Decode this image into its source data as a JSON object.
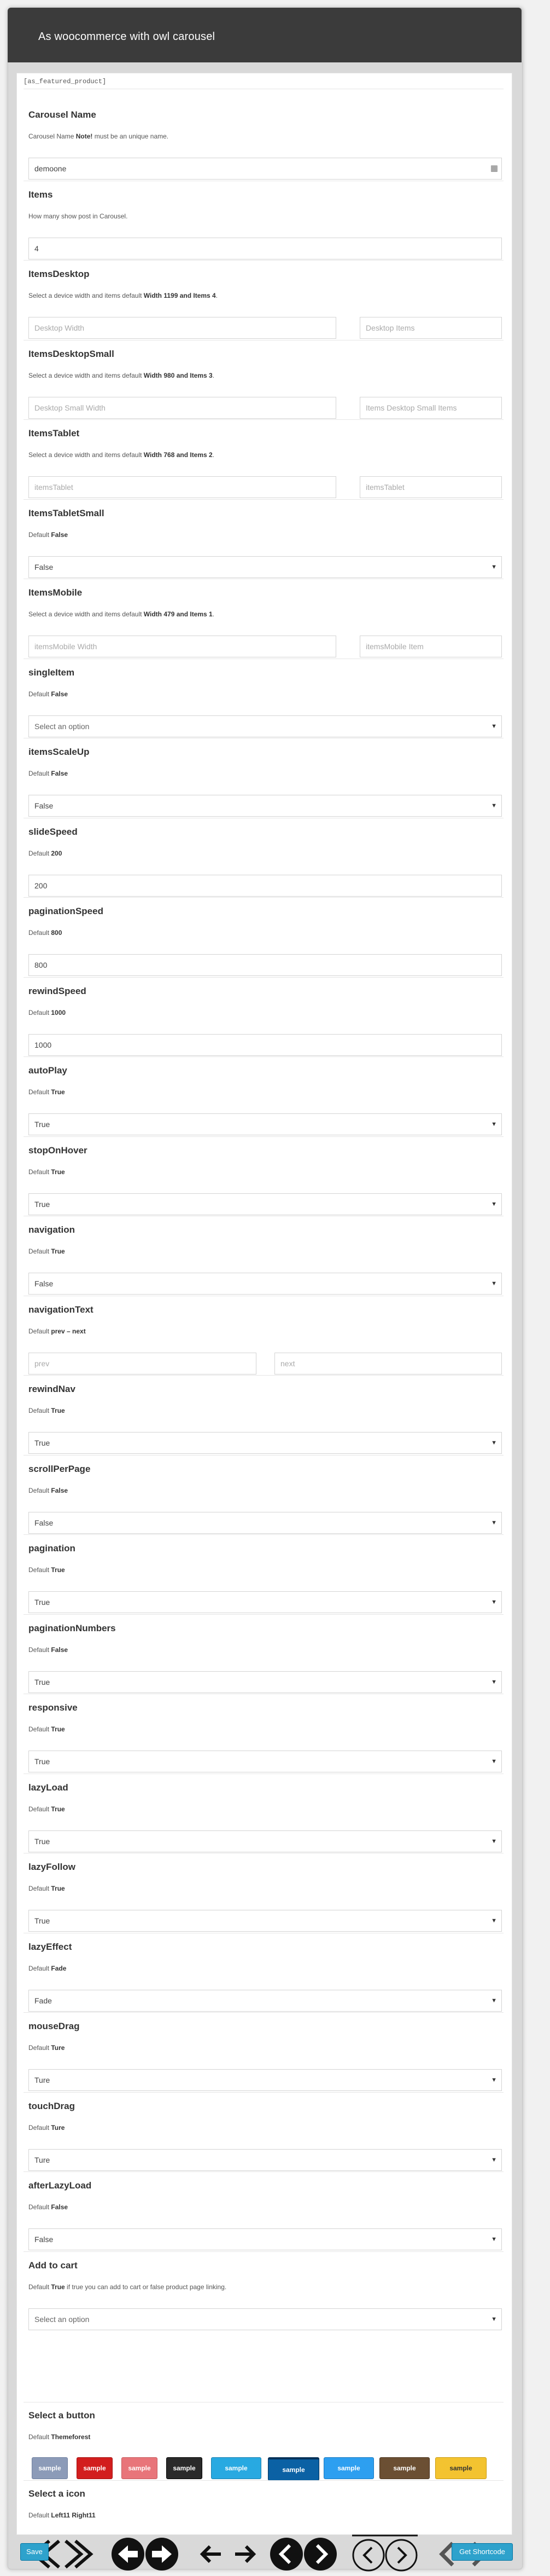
{
  "window": {
    "title": "As woocommerce with owl carousel"
  },
  "shortcode": "[as_featured_product]",
  "fields": [
    {
      "key": "carousel_name",
      "label": "Carousel Name",
      "desc": "Carousel Name <b>Note!</b> must be an unique name.",
      "type": "text",
      "value": "demoone",
      "icon": "calendar-icon"
    },
    {
      "key": "items",
      "label": "Items",
      "desc": "How many show post in Carousel.",
      "type": "text",
      "value": "4"
    },
    {
      "key": "items_desktop",
      "label": "ItemsDesktop",
      "desc": "Select a device width and items default <b>Width 1199 and Items 4</b>.",
      "type": "pair",
      "left_placeholder": "Desktop Width",
      "right_placeholder": "Desktop Items"
    },
    {
      "key": "items_desktop_small",
      "label": "ItemsDesktopSmall",
      "desc": "Select a device width and items default <b>Width 980 and Items 3</b>.",
      "type": "pair",
      "left_placeholder": "Desktop Small Width",
      "right_placeholder": "Items Desktop Small Items"
    },
    {
      "key": "items_tablet",
      "label": "ItemsTablet",
      "desc": "Select a device width and items default <b>Width 768 and Items 2</b>.",
      "type": "pair",
      "left_placeholder": "itemsTablet",
      "right_placeholder": "itemsTablet"
    },
    {
      "key": "items_tablet_small",
      "label": "ItemsTabletSmall",
      "desc": "Default <b>False</b>",
      "type": "select",
      "value": "False"
    },
    {
      "key": "items_mobile",
      "label": "ItemsMobile",
      "desc": "Select a device width and items default <b>Width 479 and Items 1</b>.",
      "type": "pair",
      "left_placeholder": "itemsMobile Width",
      "right_placeholder": "itemsMobile Item"
    },
    {
      "key": "single_item",
      "label": "singleItem",
      "desc": "Default <b>False</b>",
      "type": "select",
      "value": "Select an option",
      "muted": true
    },
    {
      "key": "items_scale_up",
      "label": "itemsScaleUp",
      "desc": "Default <b>False</b>",
      "type": "select",
      "value": "False"
    },
    {
      "key": "slide_speed",
      "label": "slideSpeed",
      "desc": "Default <b>200</b>",
      "type": "text",
      "value": "200"
    },
    {
      "key": "pagination_speed",
      "label": "paginationSpeed",
      "desc": "Default <b>800</b>",
      "type": "text",
      "value": "800"
    },
    {
      "key": "rewind_speed",
      "label": "rewindSpeed",
      "desc": "Default <b>1000</b>",
      "type": "text",
      "value": "1000"
    },
    {
      "key": "auto_play",
      "label": "autoPlay",
      "desc": "Default <b>True</b>",
      "type": "select",
      "value": "True"
    },
    {
      "key": "stop_on_hover",
      "label": "stopOnHover",
      "desc": "Default <b>True</b>",
      "type": "select",
      "value": "True"
    },
    {
      "key": "navigation",
      "label": "navigation",
      "desc": "Default <b>True</b>",
      "type": "select",
      "value": "False"
    },
    {
      "key": "navigation_text",
      "label": "navigationText",
      "desc": "Default <b>prev – next</b>",
      "type": "pair3",
      "left_placeholder": "prev",
      "right_placeholder": "next"
    },
    {
      "key": "rewind_nav",
      "label": "rewindNav",
      "desc": "Default <b>True</b>",
      "type": "select",
      "value": "True"
    },
    {
      "key": "scroll_per_page",
      "label": "scrollPerPage",
      "desc": "Default <b>False</b>",
      "type": "select",
      "value": "False"
    },
    {
      "key": "pagination",
      "label": "pagination",
      "desc": "Default <b>True</b>",
      "type": "select",
      "value": "True"
    },
    {
      "key": "pagination_numbers",
      "label": "paginationNumbers",
      "desc": "Default <b>False</b>",
      "type": "select",
      "value": "True"
    },
    {
      "key": "responsive",
      "label": "responsive",
      "desc": "Default <b>True</b>",
      "type": "select",
      "value": "True"
    },
    {
      "key": "lazy_load",
      "label": "lazyLoad",
      "desc": "Default <b>True</b>",
      "type": "select",
      "value": "True"
    },
    {
      "key": "lazy_follow",
      "label": "lazyFollow",
      "desc": "Default <b>True</b>",
      "type": "select",
      "value": "True"
    },
    {
      "key": "lazy_effect",
      "label": "lazyEffect",
      "desc": "Default <b>Fade</b>",
      "type": "select",
      "value": "Fade"
    },
    {
      "key": "mouse_drag",
      "label": "mouseDrag",
      "desc": "Default <b>Ture</b>",
      "type": "select",
      "value": "Ture"
    },
    {
      "key": "touch_drag",
      "label": "touchDrag",
      "desc": "Default <b>Ture</b>",
      "type": "select",
      "value": "Ture"
    },
    {
      "key": "after_lazy_load",
      "label": "afterLazyLoad",
      "desc": "Default <b>False</b>",
      "type": "select",
      "value": "False"
    },
    {
      "key": "add_to_cart",
      "label": "Add to cart",
      "desc": "Default <b>True</b> if true you can add to cart or false product page linking.",
      "type": "select",
      "value": "Select an option",
      "muted": true
    }
  ],
  "button_section": {
    "label": "Select a button",
    "desc": "Default <b>Themeforest</b>",
    "buttons": [
      {
        "text": "sample",
        "bg": "#8c9bb8",
        "border": "#6f7f9f",
        "color": "#ffffff"
      },
      {
        "text": "sample",
        "bg": "#d21e1e",
        "border": "#a41212",
        "color": "#ffffff"
      },
      {
        "text": "sample",
        "bg": "#e8757a",
        "border": "#c75a5f",
        "color": "#ffffff"
      },
      {
        "text": "sample",
        "bg": "#2a2a2a",
        "border": "#000000",
        "color": "#ffffff"
      },
      {
        "text": "sample",
        "bg": "#28a9e1",
        "border": "#1a7fb0",
        "color": "#ffffff"
      },
      {
        "text": "sample",
        "bg": "#0b61a4",
        "border": "#06325a",
        "color": "#ffffff"
      },
      {
        "text": "sample",
        "bg": "#2d9ff0",
        "border": "#1b7ac0",
        "color": "#ffffff"
      },
      {
        "text": "sample",
        "bg": "#6b4f33",
        "border": "#4a3420",
        "color": "#ffffff"
      },
      {
        "text": "sample",
        "bg": "#f3c330",
        "border": "#c99a10",
        "color": "#333333"
      }
    ]
  },
  "icon_section": {
    "label": "Select a icon",
    "desc": "Default <b>Left11 Right11</b>",
    "icons": [
      "double-chevron-outline-icon",
      "circle-arrow-filled-icon",
      "plain-arrow-icon",
      "circle-chevron-filled-icon",
      "circle-chevron-outline-icon",
      "gray-chevron-icon"
    ]
  },
  "footer": {
    "save_label": "Save",
    "shortcode_label": "Get Shortcode"
  },
  "colors": {
    "titlebar": "#3b3b3b",
    "primary_button": "#2ea2cc"
  }
}
